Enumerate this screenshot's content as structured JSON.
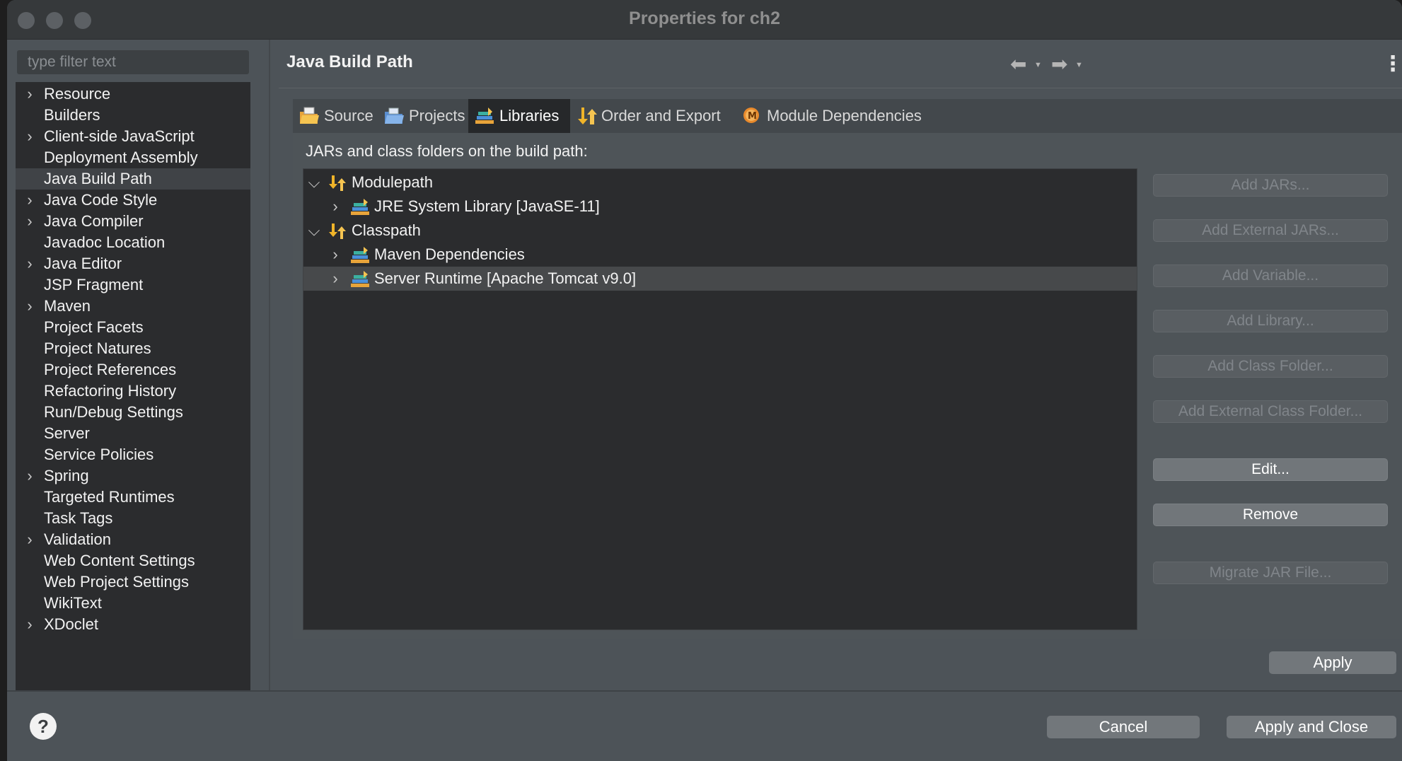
{
  "window": {
    "title": "Properties for ch2"
  },
  "sidebar": {
    "filter_placeholder": "type filter text",
    "items": [
      {
        "label": "Resource",
        "expandable": true
      },
      {
        "label": "Builders",
        "expandable": false
      },
      {
        "label": "Client-side JavaScript",
        "expandable": true
      },
      {
        "label": "Deployment Assembly",
        "expandable": false
      },
      {
        "label": "Java Build Path",
        "expandable": false,
        "selected": true
      },
      {
        "label": "Java Code Style",
        "expandable": true
      },
      {
        "label": "Java Compiler",
        "expandable": true
      },
      {
        "label": "Javadoc Location",
        "expandable": false
      },
      {
        "label": "Java Editor",
        "expandable": true
      },
      {
        "label": "JSP Fragment",
        "expandable": false
      },
      {
        "label": "Maven",
        "expandable": true
      },
      {
        "label": "Project Facets",
        "expandable": false
      },
      {
        "label": "Project Natures",
        "expandable": false
      },
      {
        "label": "Project References",
        "expandable": false
      },
      {
        "label": "Refactoring History",
        "expandable": false
      },
      {
        "label": "Run/Debug Settings",
        "expandable": false
      },
      {
        "label": "Server",
        "expandable": false
      },
      {
        "label": "Service Policies",
        "expandable": false
      },
      {
        "label": "Spring",
        "expandable": true
      },
      {
        "label": "Targeted Runtimes",
        "expandable": false
      },
      {
        "label": "Task Tags",
        "expandable": false
      },
      {
        "label": "Validation",
        "expandable": true
      },
      {
        "label": "Web Content Settings",
        "expandable": false
      },
      {
        "label": "Web Project Settings",
        "expandable": false
      },
      {
        "label": "WikiText",
        "expandable": false
      },
      {
        "label": "XDoclet",
        "expandable": true
      }
    ]
  },
  "header": {
    "title": "Java Build Path"
  },
  "tabs": [
    {
      "label": "Source",
      "icon": "source-folder-icon"
    },
    {
      "label": "Projects",
      "icon": "projects-folder-icon"
    },
    {
      "label": "Libraries",
      "icon": "libraries-icon",
      "active": true
    },
    {
      "label": "Order and Export",
      "icon": "order-export-icon"
    },
    {
      "label": "Module Dependencies",
      "icon": "module-icon"
    }
  ],
  "libraries": {
    "section_label": "JARs and class folders on the build path:",
    "tree": [
      {
        "label": "Modulepath",
        "expanded": true,
        "level": 0,
        "icon": "path-arrows-icon"
      },
      {
        "label": "JRE System Library [JavaSE-11]",
        "expanded": false,
        "level": 1,
        "icon": "library-icon"
      },
      {
        "label": "Classpath",
        "expanded": true,
        "level": 0,
        "icon": "path-arrows-icon"
      },
      {
        "label": "Maven Dependencies",
        "expanded": false,
        "level": 1,
        "icon": "library-icon"
      },
      {
        "label": "Server Runtime [Apache Tomcat v9.0]",
        "expanded": false,
        "level": 1,
        "icon": "library-icon",
        "selected": true
      }
    ],
    "buttons": [
      {
        "label": "Add JARs...",
        "enabled": false
      },
      {
        "label": "Add External JARs...",
        "enabled": false
      },
      {
        "label": "Add Variable...",
        "enabled": false
      },
      {
        "label": "Add Library...",
        "enabled": false
      },
      {
        "label": "Add Class Folder...",
        "enabled": false
      },
      {
        "label": "Add External Class Folder...",
        "enabled": false
      },
      {
        "label": "Edit...",
        "enabled": true
      },
      {
        "label": "Remove",
        "enabled": true
      },
      {
        "label": "Migrate JAR File...",
        "enabled": false
      }
    ]
  },
  "footer": {
    "apply_label": "Apply",
    "cancel_label": "Cancel",
    "apply_close_label": "Apply and Close",
    "help_symbol": "?"
  },
  "colors": {
    "window_bg": "#4d5358",
    "tree_bg": "#2b2c2e",
    "titlebar_bg": "#36393b",
    "enabled_button": "#71767a"
  }
}
